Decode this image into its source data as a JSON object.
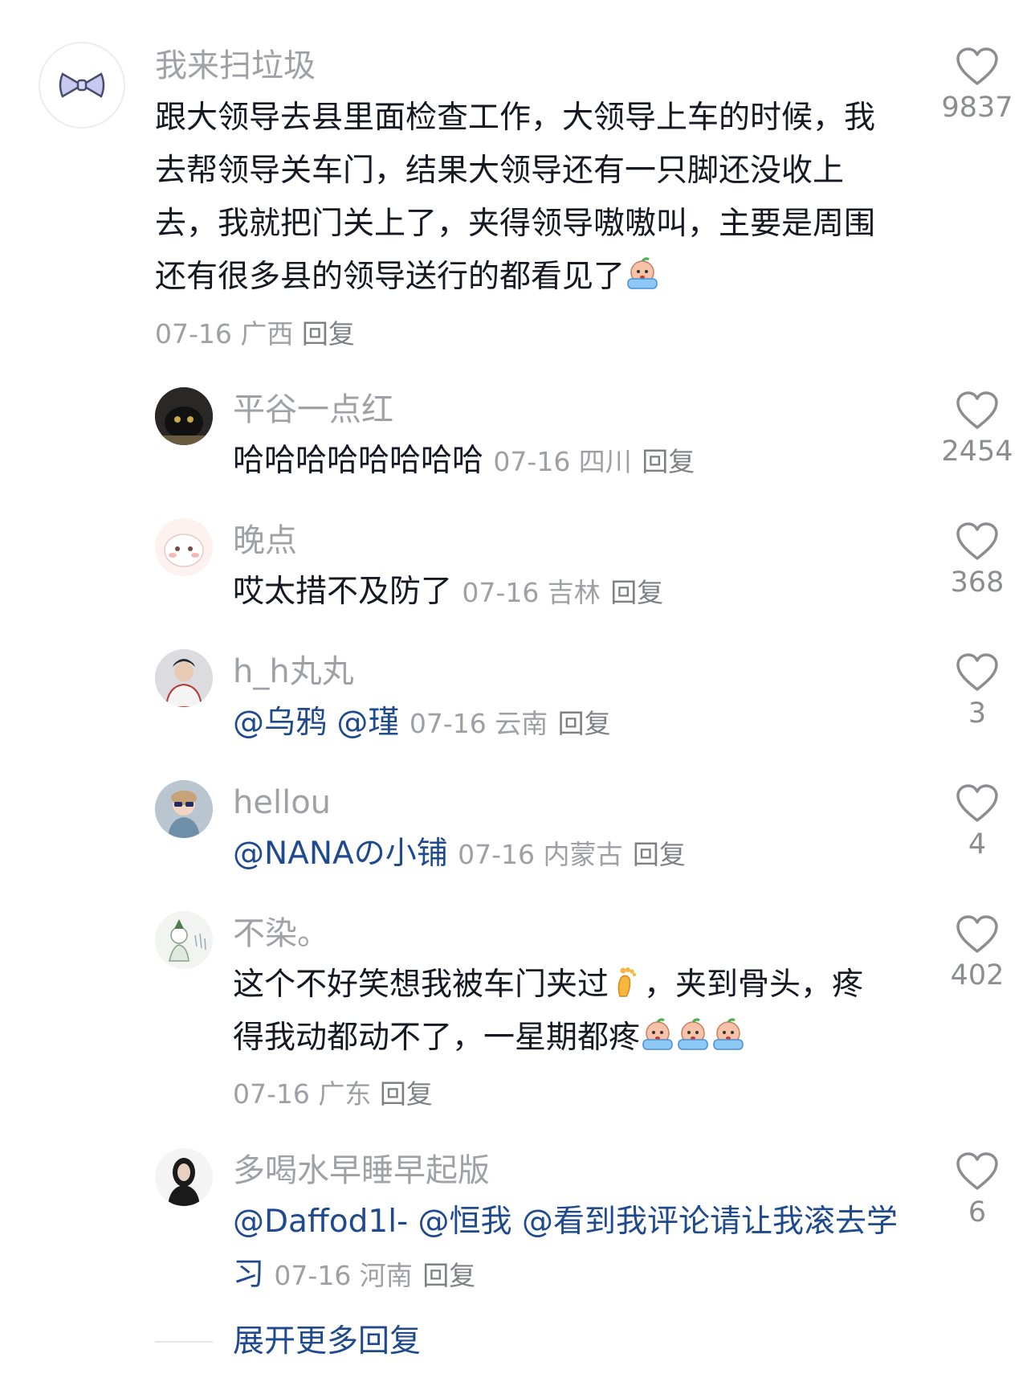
{
  "comments": {
    "main": {
      "username": "我来扫垃圾",
      "text": "跟大领导去县里面检查工作，大领导上车的时候，我去帮领导关车门，结果大领导还有一只脚还没收上去，我就把门关上了，夹得领导嗷嗷叫，主要是周围还有很多县的领导送行的都看见了",
      "emoji": "crying-emoji",
      "meta": "07-16 广西",
      "reply": "回复",
      "likes": "9837"
    },
    "replies": [
      {
        "username": "平谷一点红",
        "text": "哈哈哈哈哈哈哈哈",
        "meta": "07-16 四川",
        "reply": "回复",
        "likes": "2454"
      },
      {
        "username": "晚点",
        "text": "哎太措不及防了",
        "meta": "07-16 吉林",
        "reply": "回复",
        "likes": "368"
      },
      {
        "username": "h_h丸丸",
        "mention1": "@乌鸦",
        "mention2": "@瑾",
        "meta": "07-16 云南",
        "reply": "回复",
        "likes": "3"
      },
      {
        "username": "hellou",
        "mention1": "@NANAの小铺",
        "meta": "07-16 内蒙古",
        "reply": "回复",
        "likes": "4"
      },
      {
        "username": "不染。",
        "text1": "这个不好笑想我被车门夹过",
        "emoji1": "foot-emoji",
        "text2": "，夹到骨头，疼得我动都动不了，一星期都疼",
        "emoji2": "crying-emoji",
        "meta": "07-16 广东",
        "reply": "回复",
        "likes": "402"
      },
      {
        "username": "多喝水早睡早起版",
        "mention1": "@Daffod1l-",
        "mention2": "@恒我",
        "mention3": "@看到我评论请让我滚去学习",
        "meta": "07-16 河南",
        "reply": "回复",
        "likes": "6"
      }
    ],
    "expand_label": "展开更多回复"
  },
  "colors": {
    "mention": "#1f4a8e",
    "meta": "#9fa0a5",
    "username": "#a0a1a6",
    "text": "#161823"
  }
}
